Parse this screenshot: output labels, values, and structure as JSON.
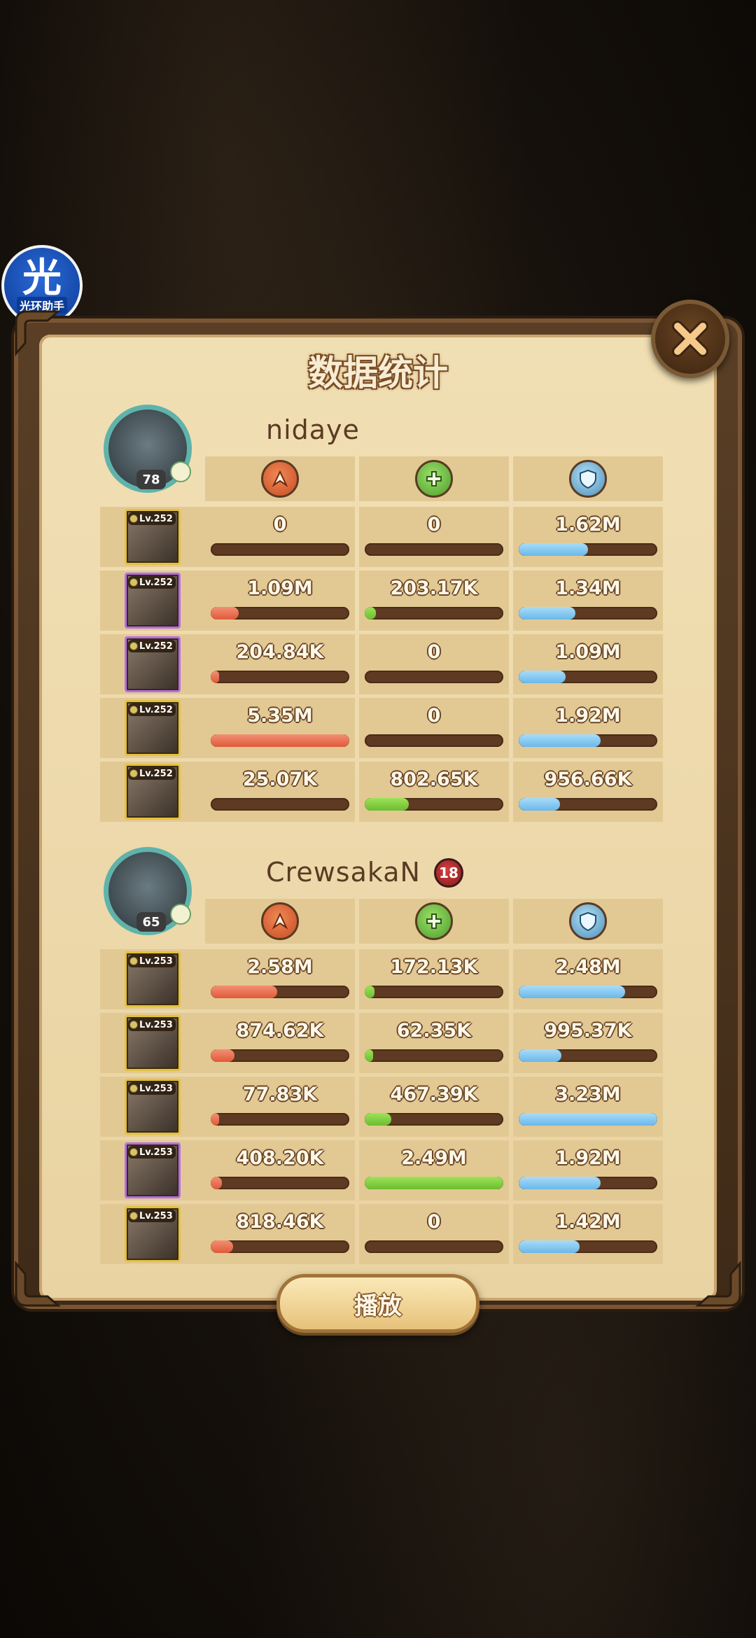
{
  "title": "数据统计",
  "helper_badge": {
    "glyph": "光",
    "label": "光环助手"
  },
  "play_button": "播放",
  "stat_headers": [
    "damage-icon",
    "heal-icon",
    "shield-icon"
  ],
  "colors": {
    "damage": "#e1593a",
    "heal": "#6cbd2f",
    "shield": "#6ab8ea"
  },
  "team1": {
    "name": "nidaye",
    "avatar_level": "78",
    "heroes": [
      {
        "level": "Lv.252",
        "frame": "gold",
        "damage": "0",
        "heal": "0",
        "shield": "1.62M",
        "damage_pct": 0,
        "heal_pct": 0,
        "shield_pct": 0.5
      },
      {
        "level": "Lv.252",
        "frame": "purple",
        "damage": "1.09M",
        "heal": "203.17K",
        "shield": "1.34M",
        "damage_pct": 0.2,
        "heal_pct": 0.08,
        "shield_pct": 0.41
      },
      {
        "level": "Lv.252",
        "frame": "purple",
        "damage": "204.84K",
        "heal": "0",
        "shield": "1.09M",
        "damage_pct": 0.04,
        "heal_pct": 0,
        "shield_pct": 0.34
      },
      {
        "level": "Lv.252",
        "frame": "gold",
        "damage": "5.35M",
        "heal": "0",
        "shield": "1.92M",
        "damage_pct": 1.0,
        "heal_pct": 0,
        "shield_pct": 0.59
      },
      {
        "level": "Lv.252",
        "frame": "gold",
        "damage": "25.07K",
        "heal": "802.65K",
        "shield": "956.66K",
        "damage_pct": 0,
        "heal_pct": 0.32,
        "shield_pct": 0.3
      }
    ]
  },
  "team2": {
    "name": "CrewsakaN",
    "avatar_level": "65",
    "badge": "18",
    "heroes": [
      {
        "level": "Lv.253",
        "frame": "gold",
        "damage": "2.58M",
        "heal": "172.13K",
        "shield": "2.48M",
        "damage_pct": 0.48,
        "heal_pct": 0.07,
        "shield_pct": 0.77
      },
      {
        "level": "Lv.253",
        "frame": "gold",
        "damage": "874.62K",
        "heal": "62.35K",
        "shield": "995.37K",
        "damage_pct": 0.17,
        "heal_pct": 0.03,
        "shield_pct": 0.31
      },
      {
        "level": "Lv.253",
        "frame": "gold",
        "damage": "77.83K",
        "heal": "467.39K",
        "shield": "3.23M",
        "damage_pct": 0.02,
        "heal_pct": 0.19,
        "shield_pct": 1.0
      },
      {
        "level": "Lv.253",
        "frame": "purple",
        "damage": "408.20K",
        "heal": "2.49M",
        "shield": "1.92M",
        "damage_pct": 0.08,
        "heal_pct": 1.0,
        "shield_pct": 0.59
      },
      {
        "level": "Lv.253",
        "frame": "gold",
        "damage": "818.46K",
        "heal": "0",
        "shield": "1.42M",
        "damage_pct": 0.16,
        "heal_pct": 0,
        "shield_pct": 0.44
      }
    ]
  }
}
